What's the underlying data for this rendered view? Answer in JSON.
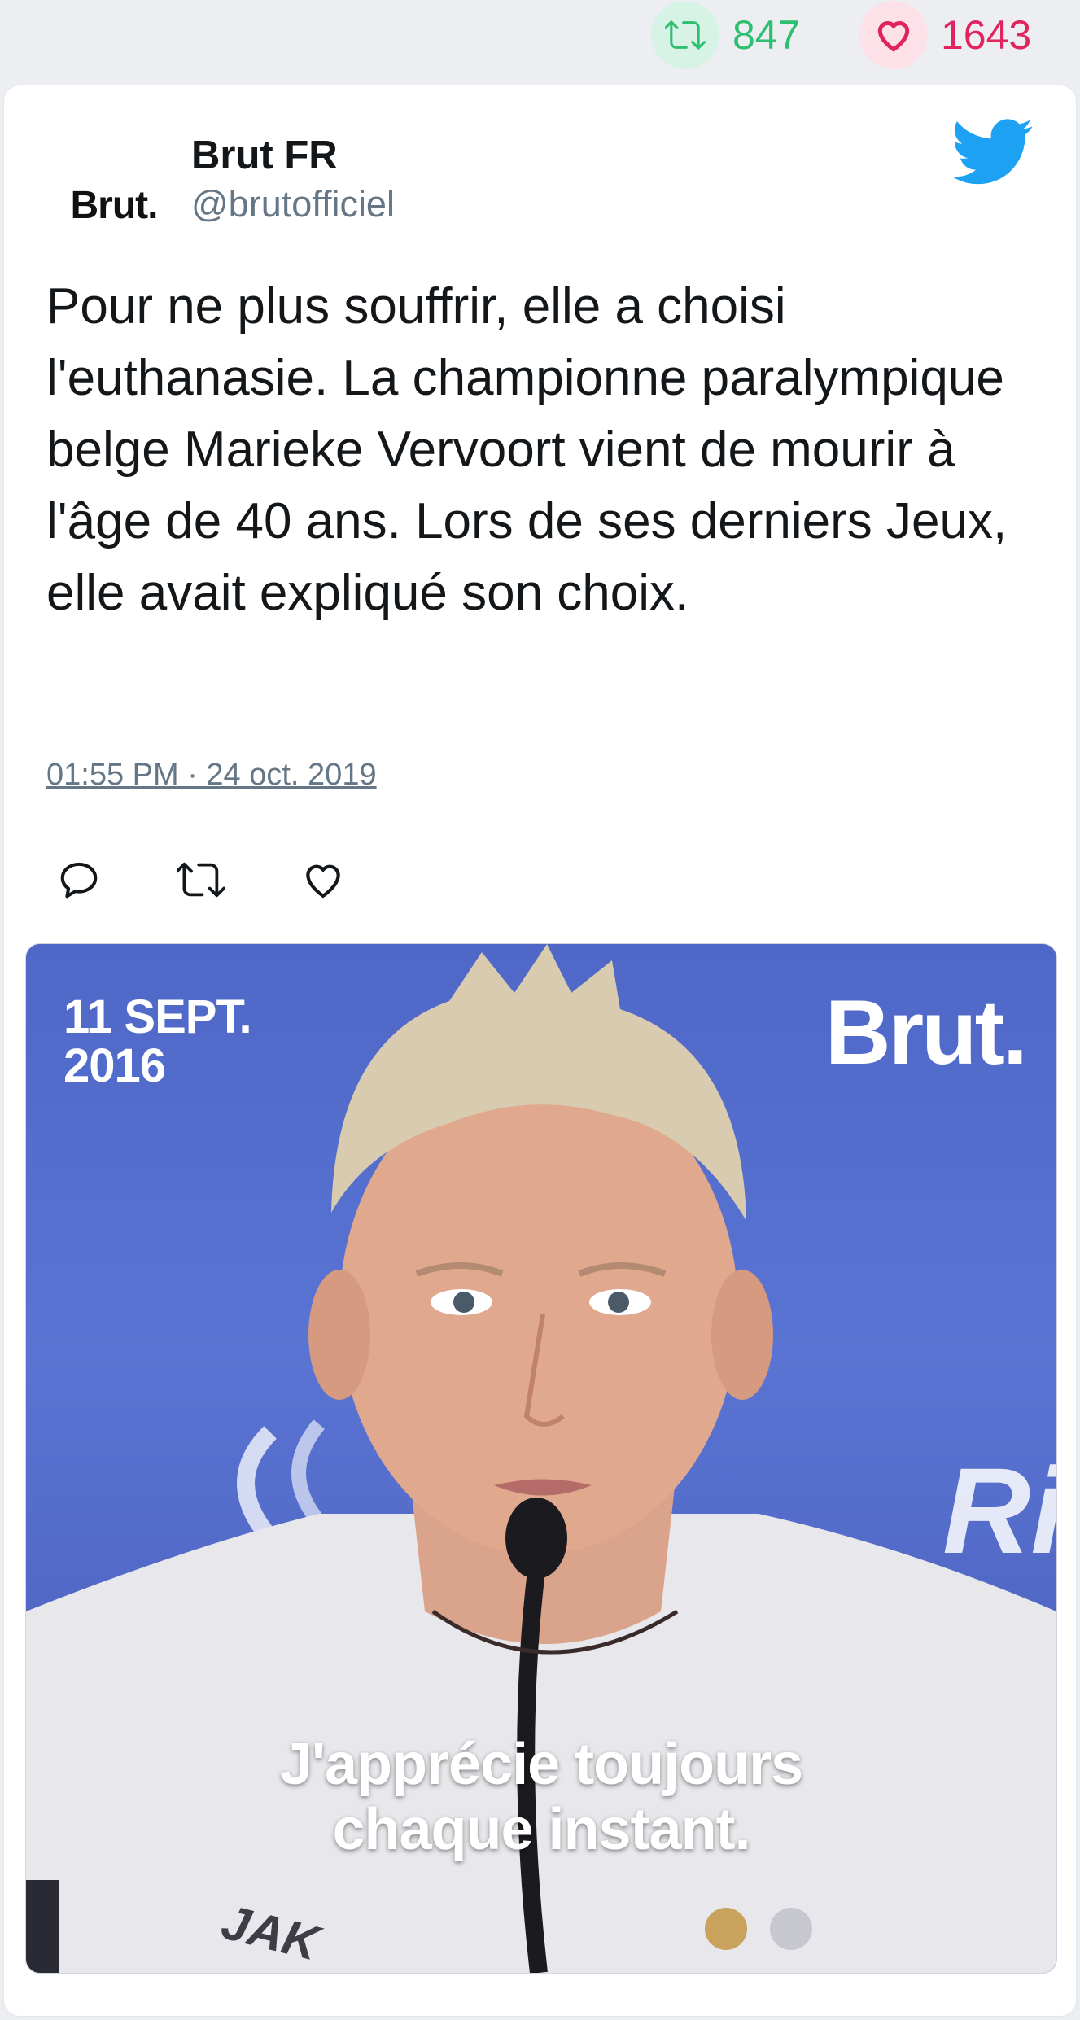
{
  "stats": {
    "retweets": "847",
    "likes": "1643"
  },
  "tweet": {
    "avatar_text": "Brut.",
    "author_name": "Brut FR",
    "author_handle": "@brutofficiel",
    "text": "Pour ne plus souffrir, elle a choisi l'euthanasie. La championne paralympique belge Marieke Vervoort vient de mourir à l'âge de 40 ans. Lors de ses derniers Jeux, elle avait expliqué son choix.",
    "timestamp": "01:55 PM · 24 oct. 2019"
  },
  "icons": [
    "retweet-icon",
    "heart-icon",
    "twitter-bird-icon",
    "reply-icon"
  ],
  "colors": {
    "retweet": "#2fbf71",
    "like": "#e0245e",
    "twitter_blue": "#1da1f2",
    "secondary_text": "#657786"
  },
  "media": {
    "date_overlay": "11 SEPT.\n2016",
    "brand_overlay": "Brut.",
    "background_text": "Ri",
    "caption": "J'apprécie toujours\nchaque instant.",
    "shirt_text": "JAK"
  }
}
